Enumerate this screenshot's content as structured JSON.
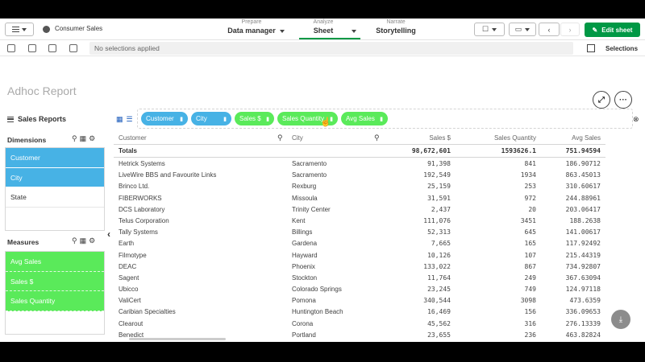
{
  "app": {
    "name": "Consumer Sales"
  },
  "nav": [
    {
      "sub": "Prepare",
      "main": "Data manager"
    },
    {
      "sub": "Analyze",
      "main": "Sheet"
    },
    {
      "sub": "Narrate",
      "main": "Storytelling"
    }
  ],
  "toolbar": {
    "edit_label": "Edit sheet",
    "selections_label": "Selections",
    "no_selections": "No selections applied"
  },
  "sheet": {
    "title": "Adhoc Report"
  },
  "panel": {
    "title": "Sales Reports",
    "dimensions_label": "Dimensions",
    "dimensions": [
      "Customer",
      "City",
      "State"
    ],
    "measures_label": "Measures",
    "measures": [
      "Avg Sales",
      "Sales $",
      "Sales Quantity"
    ]
  },
  "chips": [
    "Customer",
    "City",
    "Sales $",
    "Sales Quantity",
    "Avg Sales"
  ],
  "table": {
    "headers": [
      "Customer",
      "City",
      "Sales $",
      "Sales Quantity",
      "Avg Sales"
    ],
    "totals": {
      "label": "Totals",
      "sales": "98,672,601",
      "qty": "1593626.1",
      "avg": "751.94594"
    },
    "rows": [
      [
        "Hetrick Systems",
        "Sacramento",
        "91,398",
        "841",
        "186.90712"
      ],
      [
        "LiveWire BBS and Favourite Links",
        "Sacramento",
        "192,549",
        "1934",
        "863.45013"
      ],
      [
        "Brinco Ltd.",
        "Rexburg",
        "25,159",
        "253",
        "310.60617"
      ],
      [
        "FIBERWORKS",
        "Missoula",
        "31,591",
        "972",
        "244.88961"
      ],
      [
        "DCS Laboratory",
        "Trinity Center",
        "2,437",
        "20",
        "203.06417"
      ],
      [
        "Telus Corporation",
        "Kent",
        "111,076",
        "3451",
        "188.2638"
      ],
      [
        "Tally Systems",
        "Billings",
        "52,313",
        "645",
        "141.00617"
      ],
      [
        "Earth",
        "Gardena",
        "7,665",
        "165",
        "117.92492"
      ],
      [
        "Filmotype",
        "Hayward",
        "10,126",
        "107",
        "215.44319"
      ],
      [
        "DEAC",
        "Phoenix",
        "133,022",
        "867",
        "734.92807"
      ],
      [
        "Sagent",
        "Stockton",
        "11,764",
        "249",
        "367.63094"
      ],
      [
        "Ubicco",
        "Colorado Springs",
        "23,245",
        "749",
        "124.97118"
      ],
      [
        "ValiCert",
        "Pomona",
        "340,544",
        "3098",
        "473.6359"
      ],
      [
        "Caribian Specialties",
        "Huntington Beach",
        "16,469",
        "156",
        "336.09653"
      ],
      [
        "Clearout",
        "Corona",
        "45,562",
        "316",
        "276.13339"
      ],
      [
        "Benedict",
        "Portland",
        "23,655",
        "236",
        "463.82824"
      ]
    ]
  },
  "colors": {
    "accent": "#009845",
    "dimension": "#47b2e5",
    "measure": "#5aea5a"
  }
}
